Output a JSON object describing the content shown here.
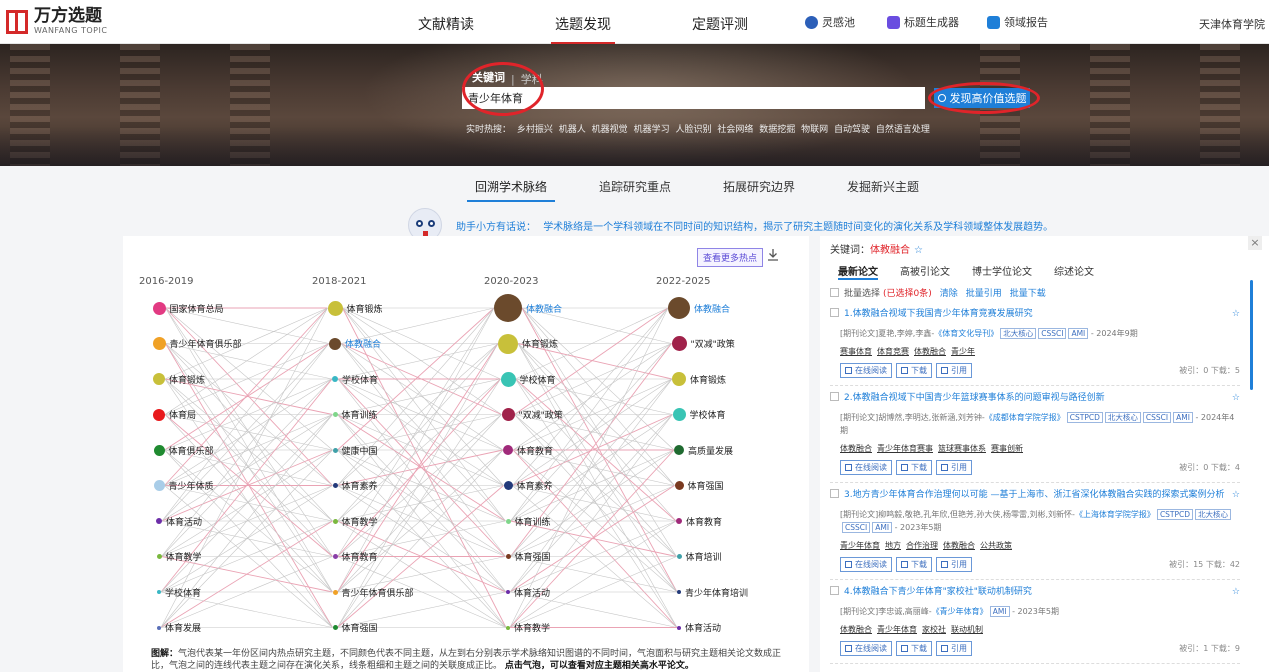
{
  "brand": {
    "cn": "万方选题",
    "en": "WANFANG TOPIC"
  },
  "nav": {
    "links": [
      {
        "label": "文献精读"
      },
      {
        "label": "选题发现"
      },
      {
        "label": "定题评测"
      }
    ],
    "tools": [
      {
        "label": "灵感池",
        "icon": "lightbulb-icon",
        "color": "#2c5fb8"
      },
      {
        "label": "标题生成器",
        "icon": "pencil-icon",
        "color": "#6a4de0"
      },
      {
        "label": "领域报告",
        "icon": "report-icon",
        "color": "#1f7fd8"
      }
    ],
    "org": "天津体育学院"
  },
  "search": {
    "tab_active": "关键词",
    "tab_other": "学科",
    "value": "青少年体育",
    "button": "发现高价值选题",
    "hot_label": "实时热搜：",
    "hot_terms": [
      "乡村振兴",
      "机器人",
      "机器视觉",
      "机器学习",
      "人脸识别",
      "社会网络",
      "数据挖掘",
      "物联网",
      "自动驾驶",
      "自然语言处理"
    ]
  },
  "subtabs": [
    "回溯学术脉络",
    "追踪研究重点",
    "拓展研究边界",
    "发掘新兴主题"
  ],
  "tip": {
    "label": "助手小方有话说：",
    "text": "学术脉络是一个学科领域在不同时间的知识结构，揭示了研究主题随时间变化的演化关系及学科领域整体发展趋势。"
  },
  "chart": {
    "more_button": "查看更多热点",
    "columns": [
      "2016-2019",
      "2018-2021",
      "2020-2023",
      "2022-2025"
    ],
    "nodes": [
      [
        {
          "label": "国家体育总局",
          "color": "#e23a82",
          "size": 13
        },
        {
          "label": "青少年体育俱乐部",
          "color": "#f0a126",
          "size": 13
        },
        {
          "label": "体育锻炼",
          "color": "#c8c03a",
          "size": 12
        },
        {
          "label": "体育局",
          "color": "#e8191c",
          "size": 12
        },
        {
          "label": "体育俱乐部",
          "color": "#1f8a30",
          "size": 11
        },
        {
          "label": "青少年体质",
          "color": "#a9cde8",
          "size": 11
        },
        {
          "label": "体育活动",
          "color": "#6c2ea8",
          "size": 6
        },
        {
          "label": "体育教学",
          "color": "#7ab83e",
          "size": 5
        },
        {
          "label": "学校体育",
          "color": "#39b7c4",
          "size": 4
        },
        {
          "label": "体育发展",
          "color": "#5a6fb8",
          "size": 4
        }
      ],
      [
        {
          "label": "体育锻炼",
          "color": "#c8c03a",
          "size": 15
        },
        {
          "label": "体教融合",
          "color": "#6b4a2c",
          "size": 12,
          "hl": true
        },
        {
          "label": "学校体育",
          "color": "#39b7c4",
          "size": 6
        },
        {
          "label": "体育训练",
          "color": "#7fd68a",
          "size": 5
        },
        {
          "label": "健康中国",
          "color": "#3fa0a8",
          "size": 5
        },
        {
          "label": "体育素养",
          "color": "#233a7a",
          "size": 5
        },
        {
          "label": "体育教学",
          "color": "#7ab83e",
          "size": 5
        },
        {
          "label": "体育教育",
          "color": "#8a3fa8",
          "size": 5
        },
        {
          "label": "青少年体育俱乐部",
          "color": "#f0a126",
          "size": 5
        },
        {
          "label": "体育强国",
          "color": "#1f8a30",
          "size": 5
        }
      ],
      [
        {
          "label": "体教融合",
          "color": "#6b4a2c",
          "size": 28,
          "hl": true
        },
        {
          "label": "体育锻炼",
          "color": "#c8c03a",
          "size": 20
        },
        {
          "label": "学校体育",
          "color": "#39c4b4",
          "size": 15
        },
        {
          "label": "\"双减\"政策",
          "color": "#a0224a",
          "size": 13
        },
        {
          "label": "体育教育",
          "color": "#a02a7a",
          "size": 10
        },
        {
          "label": "体育素养",
          "color": "#233a7a",
          "size": 9
        },
        {
          "label": "体育训练",
          "color": "#7fd68a",
          "size": 5
        },
        {
          "label": "体育强国",
          "color": "#7a3a20",
          "size": 5
        },
        {
          "label": "体育活动",
          "color": "#6c2ea8",
          "size": 4
        },
        {
          "label": "体育教学",
          "color": "#7ab83e",
          "size": 4
        }
      ],
      [
        {
          "label": "体教融合",
          "color": "#6b4a2c",
          "size": 22,
          "hl": true
        },
        {
          "label": "\"双减\"政策",
          "color": "#a0224a",
          "size": 15
        },
        {
          "label": "体育锻炼",
          "color": "#c8c03a",
          "size": 14
        },
        {
          "label": "学校体育",
          "color": "#39c4b4",
          "size": 13
        },
        {
          "label": "高质量发展",
          "color": "#1f6a30",
          "size": 10
        },
        {
          "label": "体育强国",
          "color": "#7a3a20",
          "size": 9
        },
        {
          "label": "体育教育",
          "color": "#a02a7a",
          "size": 6
        },
        {
          "label": "体育培训",
          "color": "#3fa0a8",
          "size": 5
        },
        {
          "label": "青少年体育培训",
          "color": "#233a7a",
          "size": 4
        },
        {
          "label": "体育活动",
          "color": "#6c2ea8",
          "size": 4
        }
      ]
    ],
    "caption_lead": "图解：",
    "caption": "气泡代表某一年份区间内热点研究主题，不同颜色代表不同主题，从左到右分别表示学术脉络知识图谱的不同时间，气泡面积与研究主题相关论文数成正比，气泡之间的连线代表主题之间存在演化关系，线条粗细和主题之间的关联度成正比。",
    "caption_bold": "点击气泡，可以查看对应主题相关高水平论文。"
  },
  "papers_panel": {
    "kw_label": "关键词：",
    "kw_value": "体教融合",
    "tabs": [
      "最新论文",
      "高被引论文",
      "博士学位论文",
      "综述论文"
    ],
    "bulk": {
      "select": "批量选择",
      "selected": "(已选择0条)",
      "clear": "清除",
      "cite": "批量引用",
      "download": "批量下载"
    },
    "actions": {
      "read": "在线阅读",
      "download": "下载",
      "cite": "引用"
    },
    "papers": [
      {
        "title": "1.体教融合视域下我国青少年体育竞赛发展研究",
        "type": "[期刊论文]",
        "authors": "夏艳,李婷,李鑫-",
        "source": "《体育文化导刊》",
        "badges": [
          "北大核心",
          "CSSCI",
          "AMI"
        ],
        "date": "- 2024年9期",
        "keywords": [
          "赛事体育",
          "体育竞赛",
          "体教融合",
          "青少年"
        ],
        "stats": "被引：0 下载：5"
      },
      {
        "title": "2.体教融合视域下中国青少年篮球赛事体系的问题审视与路径创新",
        "type": "[期刊论文]",
        "authors": "胡博然,李明达,张新涵,刘芳钟-",
        "source": "《成都体育学院学报》",
        "badges": [
          "CSTPCD",
          "北大核心",
          "CSSCI",
          "AMI"
        ],
        "date": "- 2024年4期",
        "keywords": [
          "体教融合",
          "青少年体育赛事",
          "篮球赛事体系",
          "赛事创新"
        ],
        "stats": "被引：0 下载：4"
      },
      {
        "title": "3.地方青少年体育合作治理何以可能 —基于上海市、浙江省深化体教融合实践的探索式案例分析",
        "type": "[期刊论文]",
        "authors": "柳鸣毅,敬艳,孔年欣,但艳芳,孙大侠,杨零雷,刘彬,刘新怀-",
        "source": "《上海体育学院学报》",
        "badges": [
          "CSTPCD",
          "北大核心",
          "CSSCI",
          "AMI"
        ],
        "date": "- 2023年5期",
        "keywords": [
          "青少年体育",
          "地方",
          "合作治理",
          "体教融合",
          "公共政策"
        ],
        "stats": "被引：15 下载：42"
      },
      {
        "title": "4.体教融合下青少年体育\"家校社\"联动机制研究",
        "type": "[期刊论文]",
        "authors": "李忠诚,高丽峰-",
        "source": "《青少年体育》",
        "badges": [
          "AMI"
        ],
        "date": "- 2023年5期",
        "keywords": [
          "体教融合",
          "青少年体育",
          "家校社",
          "联动机制"
        ],
        "stats": "被引：1 下载：9"
      }
    ]
  }
}
